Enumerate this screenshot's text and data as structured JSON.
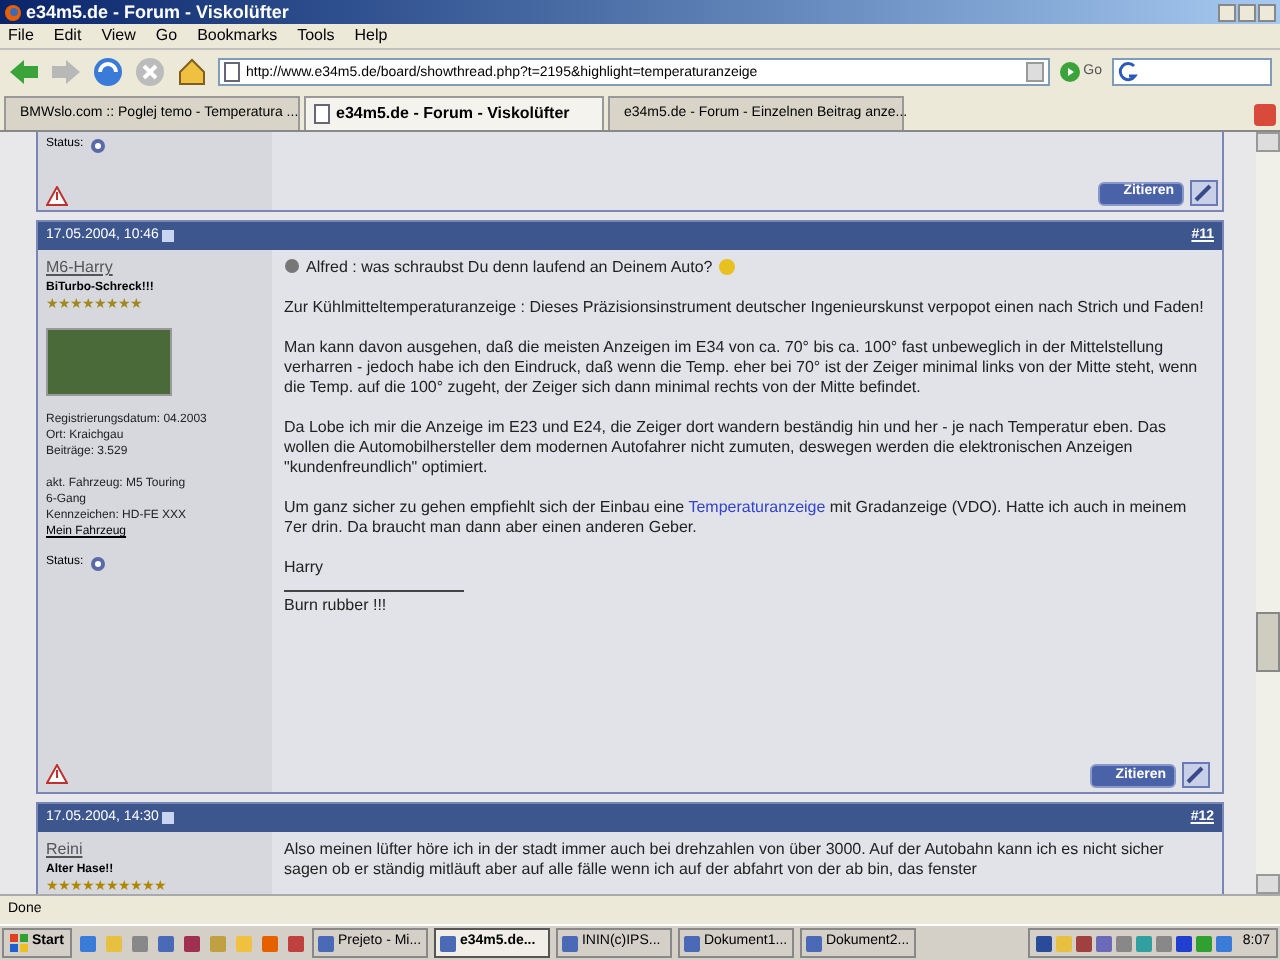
{
  "window": {
    "title": "e34m5.de - Forum - Viskolüfter"
  },
  "menu": [
    "File",
    "Edit",
    "View",
    "Go",
    "Bookmarks",
    "Tools",
    "Help"
  ],
  "toolbar": {
    "url": "http://www.e34m5.de/board/showthread.php?t=2195&highlight=temperaturanzeige",
    "go_label": "Go"
  },
  "tabs": [
    {
      "label": "BMWslo.com :: Poglej temo - Temperatura ...",
      "selected": false
    },
    {
      "label": "e34m5.de - Forum - Viskolüfter",
      "selected": true
    },
    {
      "label": "e34m5.de - Forum - Einzelnen Beitrag anze...",
      "selected": false
    }
  ],
  "previous_post": {
    "status_label": "Status:",
    "quote_button": "Zitieren"
  },
  "posts": [
    {
      "date": "17.05.2004, 10:46",
      "number": "#11",
      "author": "M6-Harry",
      "rank": "BiTurbo-Schreck!!!",
      "stars": 8,
      "has_photo": true,
      "info": [
        [
          "Registrierungsdatum: 04.2003",
          "Ort: Kraichgau",
          "Beiträge: 3.529"
        ],
        [
          "akt. Fahrzeug: M5 Touring",
          "6-Gang",
          "Kennzeichen: HD-FE XXX"
        ]
      ],
      "vehicle_link": "Mein Fahrzeug",
      "status_label": "Status:",
      "paragraphs": [
        "Alfred : was schraubst Du denn laufend an Deinem Auto?",
        "Zur Kühlmitteltemperaturanzeige : Dieses Präzisionsinstrument deutscher Ingenieurskunst verpopot einen nach Strich und Faden!",
        "Man kann davon ausgehen, daß die meisten Anzeigen im E34 von ca. 70° bis ca. 100° fast unbeweglich in der Mittelstellung verharren - jedoch habe ich den Eindruck, daß wenn die Temp. eher bei 70° ist der Zeiger minimal links von der Mitte steht, wenn die Temp. auf die 100° zugeht, der Zeiger sich dann minimal rechts von der Mitte befindet.",
        "Da Lobe ich mir die Anzeige im E23 und E24, die Zeiger dort wandern beständig hin und her - je nach Temperatur eben. Das wollen die Automobilhersteller dem modernen Autofahrer nicht zumuten, deswegen werden die elektronischen Anzeigen \"kundenfreundlich\" optimiert.",
        {
          "before": "Um ganz sicher zu gehen empfiehlt sich der Einbau eine",
          "link": "Temperaturanzeige",
          "after": "mit Gradanzeige (VDO). Hatte ich auch in meinem 7er drin. Da braucht man dann aber einen anderen Geber."
        },
        "Harry"
      ],
      "signature": "Burn rubber !!!",
      "quote_button": "Zitieren"
    },
    {
      "date": "17.05.2004, 14:30",
      "number": "#12",
      "author": "Reini",
      "rank": "Alter Hase!!",
      "stars": 10,
      "has_photo": false,
      "paragraphs": [
        "Also meinen lüfter höre ich in der stadt immer auch bei drehzahlen von über 3000. Auf der Autobahn kann ich es nicht sicher sagen ob er ständig mitläuft aber auf alle fälle wenn ich auf der abfahrt von der ab bin, das fenster"
      ]
    }
  ],
  "status_bar": "Done",
  "taskbar": {
    "start": "Start",
    "tasks": [
      {
        "label": "Prejeto - Mi...",
        "selected": false
      },
      {
        "label": "e34m5.de...",
        "selected": true
      },
      {
        "label": "ININ(c)IPS...",
        "selected": false
      },
      {
        "label": "Dokument1...",
        "selected": false
      },
      {
        "label": "Dokument2...",
        "selected": false
      }
    ],
    "clock": "8:07"
  }
}
